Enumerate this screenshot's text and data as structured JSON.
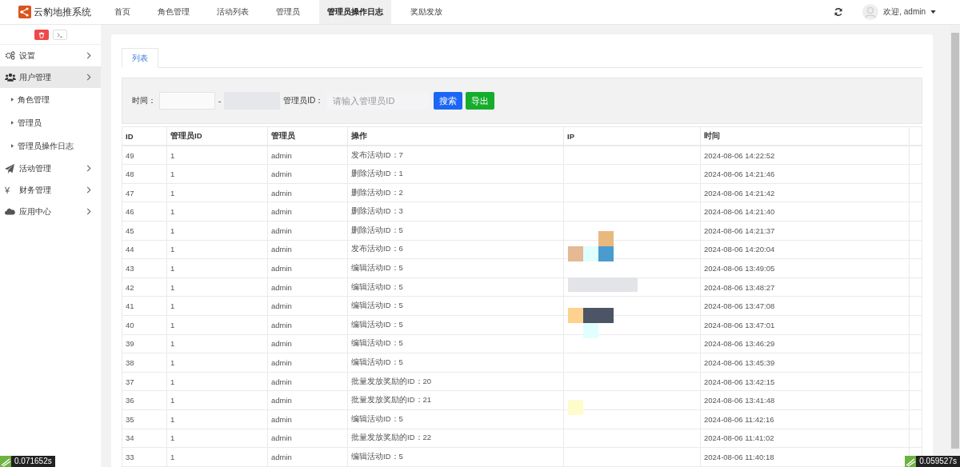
{
  "header": {
    "brand": "云豹地推系统",
    "nav": [
      {
        "label": "首页",
        "selected": false
      },
      {
        "label": "角色管理",
        "selected": false
      },
      {
        "label": "活动列表",
        "selected": false
      },
      {
        "label": "管理员",
        "selected": false
      },
      {
        "label": "管理员操作日志",
        "selected": true
      },
      {
        "label": "奖励发放",
        "selected": false
      }
    ],
    "user": "欢迎, admin"
  },
  "sidebar": {
    "items": [
      {
        "label": "设置",
        "kind": "gear",
        "selected": false
      },
      {
        "label": "用户管理",
        "kind": "users",
        "selected": true,
        "children": [
          {
            "label": "角色管理"
          },
          {
            "label": "管理员"
          },
          {
            "label": "管理员操作日志"
          }
        ]
      },
      {
        "label": "活动管理",
        "kind": "plane",
        "selected": false
      },
      {
        "label": "财务管理",
        "kind": "yen",
        "icon_text": "¥",
        "selected": false
      },
      {
        "label": "应用中心",
        "kind": "cloud",
        "selected": false
      }
    ]
  },
  "tabs": [
    {
      "label": "列表",
      "selected": true
    }
  ],
  "filter": {
    "time_label": "时间：",
    "separator": "-",
    "admin_label": "管理员ID：",
    "admin_placeholder": "请输入管理员ID",
    "search": "搜索",
    "export": "导出"
  },
  "table": {
    "columns": [
      "ID",
      "管理员ID",
      "管理员",
      "操作",
      "IP",
      "时间"
    ],
    "rows": [
      [
        "49",
        "1",
        "admin",
        "发布活动ID：7",
        "2024-08-06 14:22:52"
      ],
      [
        "48",
        "1",
        "admin",
        "删除活动ID：1",
        "2024-08-06 14:21:46"
      ],
      [
        "47",
        "1",
        "admin",
        "删除活动ID：2",
        "2024-08-06 14:21:42"
      ],
      [
        "46",
        "1",
        "admin",
        "删除活动ID：3",
        "2024-08-06 14:21:40"
      ],
      [
        "45",
        "1",
        "admin",
        "删除活动ID：5",
        "2024-08-06 14:21:37"
      ],
      [
        "44",
        "1",
        "admin",
        "发布活动ID：6",
        "2024-08-06 14:20:04"
      ],
      [
        "43",
        "1",
        "admin",
        "编辑活动ID：5",
        "2024-08-06 13:49:05"
      ],
      [
        "42",
        "1",
        "admin",
        "编辑活动ID：5",
        "2024-08-06 13:48:27"
      ],
      [
        "41",
        "1",
        "admin",
        "编辑活动ID：5",
        "2024-08-06 13:47:08"
      ],
      [
        "40",
        "1",
        "admin",
        "编辑活动ID：5",
        "2024-08-06 13:47:01"
      ],
      [
        "39",
        "1",
        "admin",
        "编辑活动ID：5",
        "2024-08-06 13:46:29"
      ],
      [
        "38",
        "1",
        "admin",
        "编辑活动ID：5",
        "2024-08-06 13:45:39"
      ],
      [
        "37",
        "1",
        "admin",
        "批量发放奖励的ID：20",
        "2024-08-06 13:42:15"
      ],
      [
        "36",
        "1",
        "admin",
        "批量发放奖励的ID：21",
        "2024-08-06 13:41:48"
      ],
      [
        "35",
        "1",
        "admin",
        "编辑活动ID：5",
        "2024-08-06 11:42:16"
      ],
      [
        "34",
        "1",
        "admin",
        "批量发放奖励的ID：22",
        "2024-08-06 11:41:02"
      ],
      [
        "33",
        "1",
        "admin",
        "编辑活动ID：5",
        "2024-08-06 11:40:18"
      ]
    ]
  },
  "timers": [
    "0.071652s",
    "0.059527s"
  ]
}
